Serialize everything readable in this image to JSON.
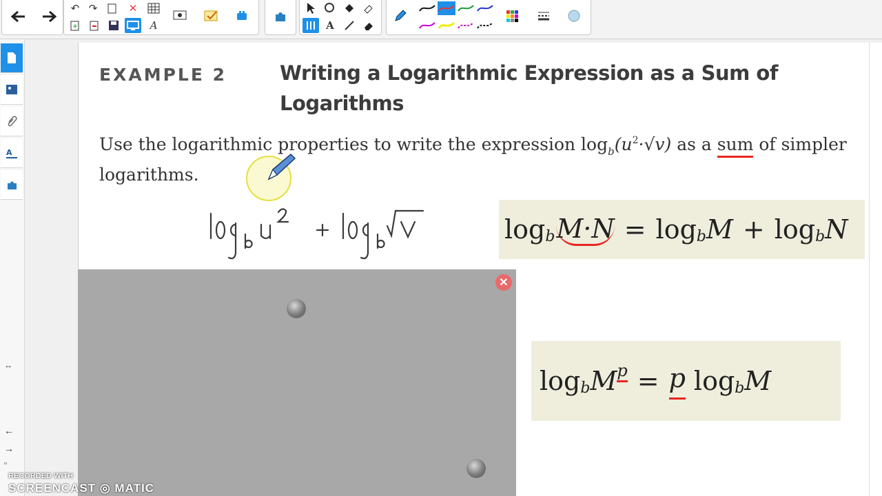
{
  "toolbar": {
    "icons": [
      "back-arrow",
      "forward-arrow",
      "undo",
      "redo",
      "new-page",
      "delete",
      "table",
      "clone-page",
      "export",
      "save",
      "screen",
      "handwriting",
      "screen-capture",
      "check",
      "add-ons",
      "puzzle",
      "select-arrow",
      "shapes",
      "fill",
      "eraser-tool",
      "pens",
      "text",
      "line",
      "eraser",
      "pen",
      "color-palette",
      "line-style",
      "magic"
    ]
  },
  "sidebar": {
    "icons": [
      "page-sorter",
      "gallery",
      "attachments",
      "properties",
      "add-ons",
      "collapse",
      "prev-page",
      "next-page",
      "page-file"
    ]
  },
  "example": {
    "label": "EXAMPLE 2",
    "title": "Writing a Logarithmic Expression as a Sum of Logarithms",
    "problem_prefix": "Use the logarithmic properties to write the expression log",
    "problem_sub_b": "b",
    "problem_expr_open": "(u",
    "problem_expr_sup": "2",
    "problem_expr_rest": "·√v)",
    "problem_suffix_a": " as a ",
    "problem_emphasis": "sum",
    "problem_suffix_b": " of simpler logarithms."
  },
  "handwriting": {
    "text": "log_b u^2 + log_b √v"
  },
  "rules": {
    "product": {
      "log": "log",
      "sub": "b",
      "lhs_args": "M·N",
      "equals": "=",
      "log_m": "M",
      "plus": "+",
      "log_n": "N"
    },
    "power": {
      "log": "log",
      "sub": "b",
      "lhs_base": "M",
      "lhs_exp": "p",
      "equals": "=",
      "coef": "p",
      "rhs_arg": "M"
    }
  },
  "panel": {
    "close_symbol": "✕"
  },
  "watermark": {
    "line1": "RECORDED WITH",
    "line2": "SCREENCAST ◎ MATIC"
  },
  "colors": {
    "annotation_red": "#e8251f",
    "highlight_yellow": "#f2ef7a",
    "accent_blue": "#1e90e8",
    "rule_box_bg": "#efeddc"
  }
}
